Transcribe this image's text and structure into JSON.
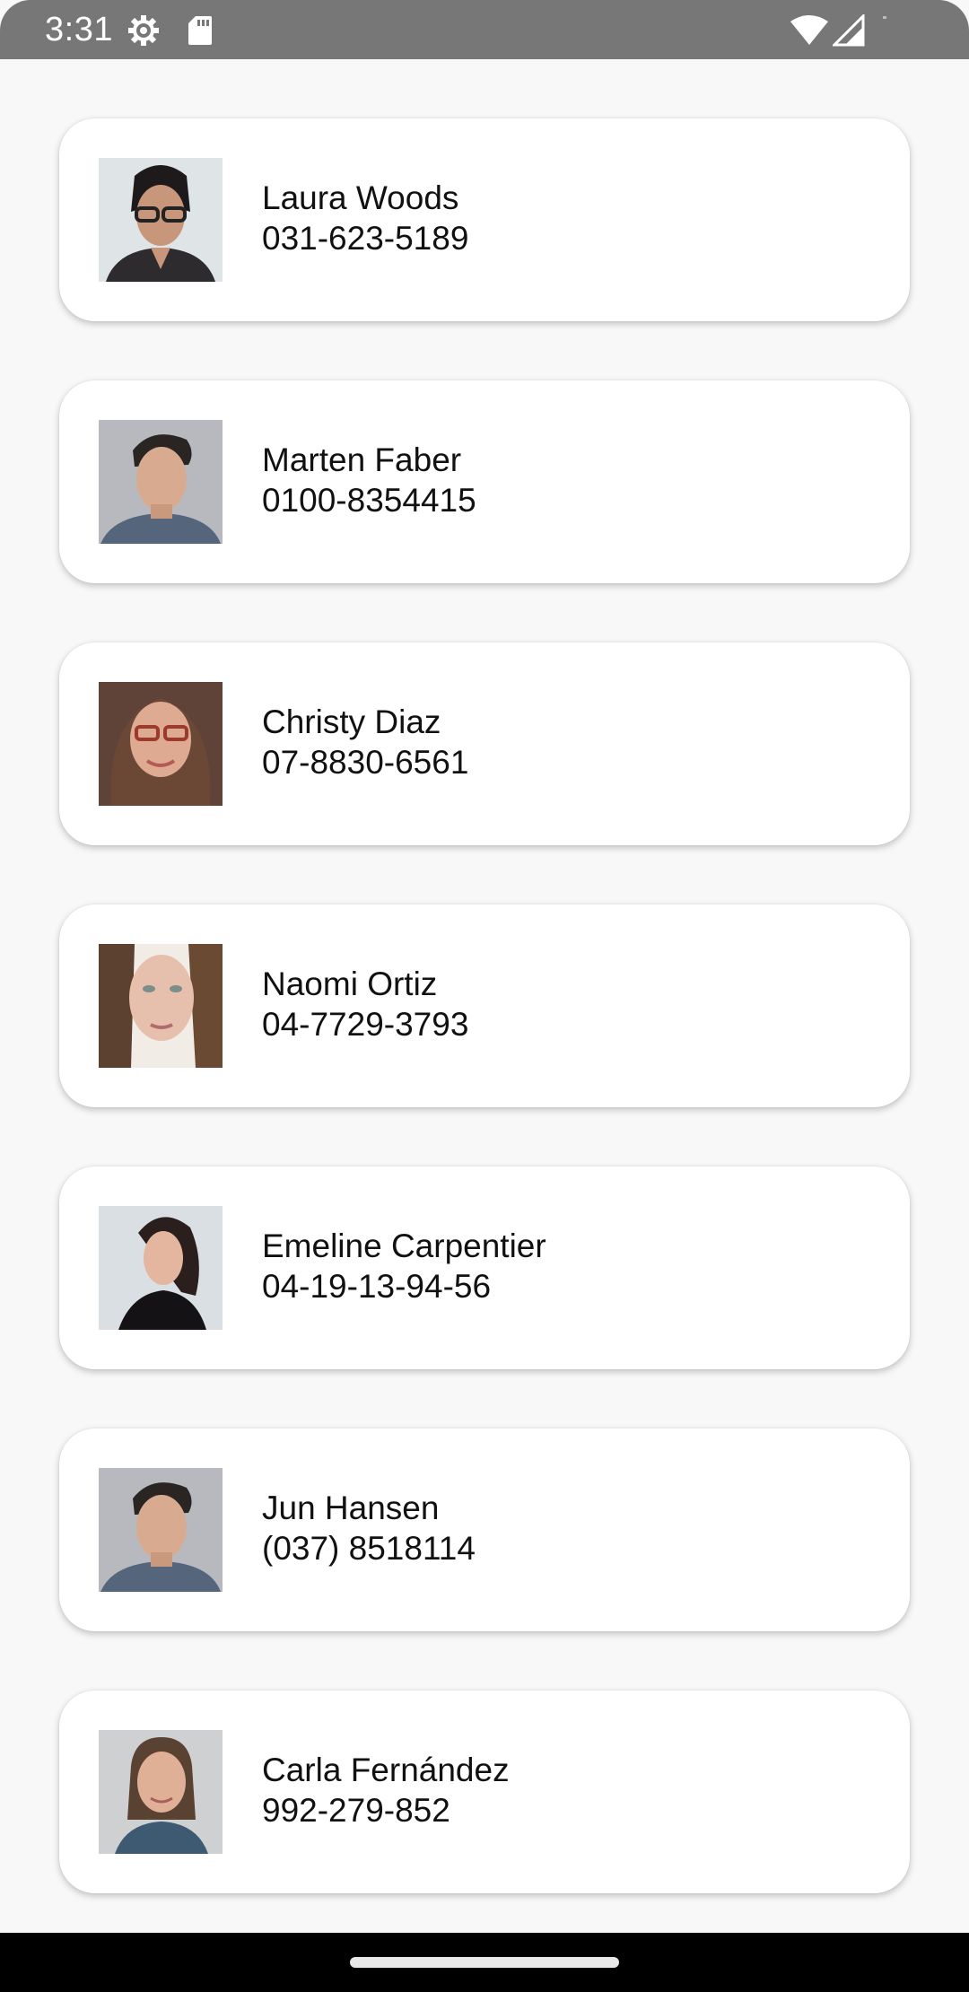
{
  "status_bar": {
    "time": "3:31",
    "icons": [
      "settings-icon",
      "sd-card-icon",
      "wifi-icon",
      "cell-signal-icon"
    ]
  },
  "contacts": [
    {
      "name": "Laura Woods",
      "phone": "031-623-5189",
      "avatar": "avatar-photo"
    },
    {
      "name": "Marten Faber",
      "phone": "0100-8354415",
      "avatar": "avatar-photo"
    },
    {
      "name": "Christy Diaz",
      "phone": "07-8830-6561",
      "avatar": "avatar-photo"
    },
    {
      "name": "Naomi Ortiz",
      "phone": "04-7729-3793",
      "avatar": "avatar-photo"
    },
    {
      "name": "Emeline Carpentier",
      "phone": "04-19-13-94-56",
      "avatar": "avatar-photo"
    },
    {
      "name": "Jun Hansen",
      "phone": "(037) 8518114",
      "avatar": "avatar-photo"
    },
    {
      "name": "Carla Fernández",
      "phone": "992-279-852",
      "avatar": "avatar-photo"
    }
  ],
  "colors": {
    "background": "#f8f8f8",
    "card": "#ffffff",
    "status_bar": "#777777",
    "nav_bar": "#000000",
    "text": "#111111"
  }
}
